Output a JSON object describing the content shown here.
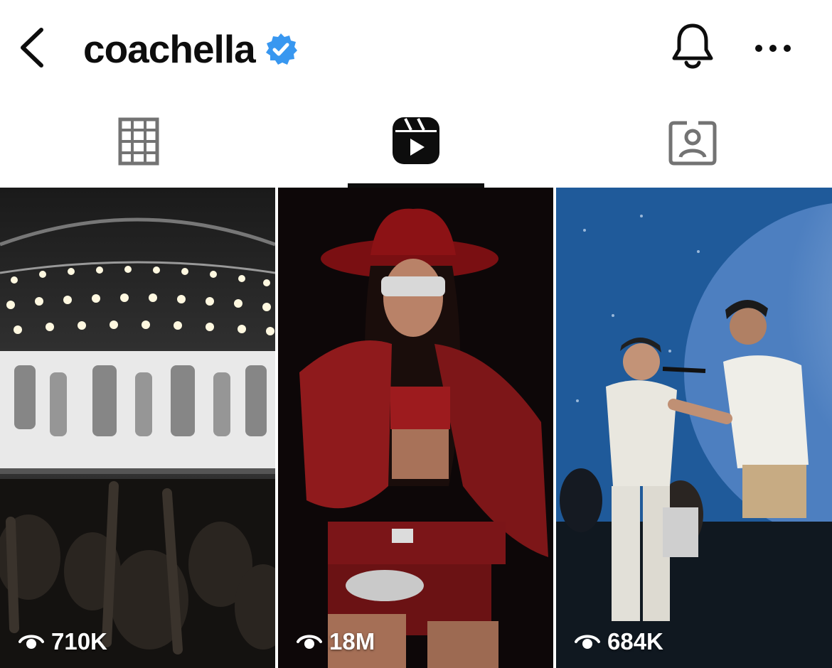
{
  "header": {
    "title": "coachella",
    "back_icon": "chevron-left-icon",
    "verified_icon": "verified-badge-icon",
    "notification_icon": "bell-icon",
    "more_icon": "more-horizontal-icon"
  },
  "tabs": [
    {
      "name": "posts",
      "icon": "grid-icon",
      "active": false
    },
    {
      "name": "reels",
      "icon": "reels-icon",
      "active": true
    },
    {
      "name": "tagged",
      "icon": "tagged-user-icon",
      "active": false
    }
  ],
  "reels": [
    {
      "views": "710K",
      "icon": "eye-icon"
    },
    {
      "views": "18M",
      "icon": "eye-icon"
    },
    {
      "views": "684K",
      "icon": "eye-icon"
    }
  ],
  "colors": {
    "text": "#0d0d0d",
    "verified": "#3897f0",
    "inactive_tab": "#737373"
  }
}
